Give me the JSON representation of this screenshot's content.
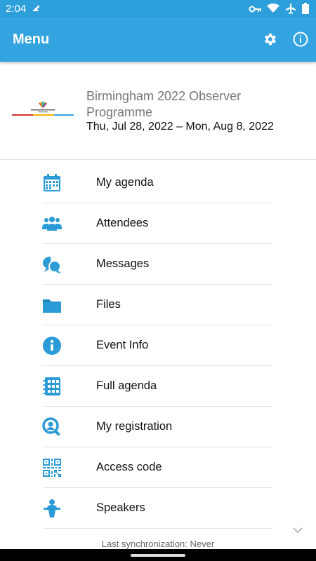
{
  "status_bar": {
    "time": "2:04",
    "icons": [
      "notification-icon",
      "vpn-key-icon",
      "wifi-icon",
      "airplane-icon",
      "battery-icon"
    ]
  },
  "app_bar": {
    "title": "Menu",
    "icons": [
      "gear-icon",
      "info-icon"
    ],
    "color": "#34a4e0"
  },
  "event": {
    "name": "Birmingham 2022 Observer Programme",
    "dates": "Thu, Jul 28, 2022 – Mon, Aug 8, 2022"
  },
  "menu": {
    "items": [
      {
        "label": "My agenda",
        "icon": "calendar-icon"
      },
      {
        "label": "Attendees",
        "icon": "people-icon"
      },
      {
        "label": "Messages",
        "icon": "chat-icon"
      },
      {
        "label": "Files",
        "icon": "folder-icon"
      },
      {
        "label": "Event Info",
        "icon": "info-circle-icon"
      },
      {
        "label": "Full agenda",
        "icon": "agenda-grid-icon"
      },
      {
        "label": "My registration",
        "icon": "registration-icon"
      },
      {
        "label": "Access code",
        "icon": "qr-code-icon"
      },
      {
        "label": "Speakers",
        "icon": "speaker-icon"
      }
    ],
    "icon_color": "#2b9bd7"
  },
  "footer": {
    "sync_text": "Last synchronization: Never"
  }
}
